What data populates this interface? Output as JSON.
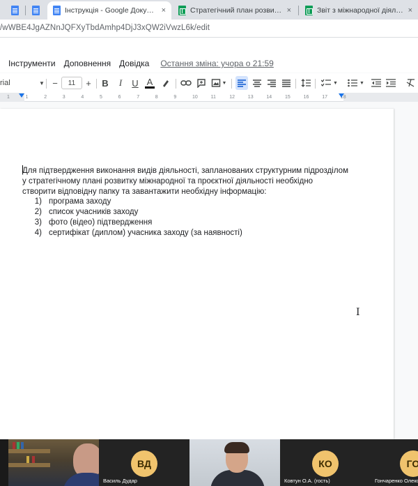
{
  "browser": {
    "tabs": [
      {
        "title": "",
        "icon": "docs-icon"
      },
      {
        "title": "",
        "icon": "docs-icon"
      },
      {
        "title": "Інструкція - Google Документи",
        "icon": "docs-icon",
        "active": true
      },
      {
        "title": "Стратегічний план розвитку між",
        "icon": "sheets-icon"
      },
      {
        "title": "Звіт з міжнародної діяльності -",
        "icon": "sheets-icon"
      }
    ],
    "close_glyph": "×",
    "url": "/wWBE4JgAZNnJQFXyTbdAmhp4DjJ3xQW2iVwzL6k/edit"
  },
  "menubar": {
    "items": [
      "Інструменти",
      "Доповнення",
      "Довідка"
    ],
    "last_edit": "Остання зміна: учора о 21:59"
  },
  "toolbar": {
    "font": "rial",
    "font_size": "11",
    "minus": "−",
    "plus": "+",
    "bold": "B",
    "italic": "I",
    "underline": "U",
    "text_color": "A",
    "highlight_color": "#fbbc04",
    "text_color_value": "#000000"
  },
  "ruler": {
    "ticks": [
      "1",
      "1",
      "2",
      "3",
      "4",
      "5",
      "6",
      "7",
      "8",
      "9",
      "10",
      "11",
      "12",
      "13",
      "14",
      "15",
      "16",
      "17",
      "18"
    ]
  },
  "document": {
    "paragraph": [
      "Для підтвердження виконання видів діяльності, запланованих структурним підрозділом",
      "у стратегічному плані розвитку міжнародної та проєктної діяльності необхідно",
      "створити відповідну папку та завантажити необхідну  інформацію:"
    ],
    "list": [
      {
        "num": "1)",
        "text": "програма заходу"
      },
      {
        "num": "2)",
        "text": "список учасників заходу"
      },
      {
        "num": "3)",
        "text": "фото (відео) підтвердження"
      },
      {
        "num": "4)",
        "text": "сертифікат (диплом) учасника заходу (за наявності)"
      }
    ]
  },
  "video": {
    "participants": [
      {
        "name": "",
        "type": "photo"
      },
      {
        "name": "Василь Дудар",
        "initials": "ВД",
        "type": "avatar"
      },
      {
        "name": "",
        "type": "photo"
      },
      {
        "name": "Ковтун О.А. (гость)",
        "initials": "КО",
        "type": "avatar"
      },
      {
        "name": "Гончаренко Олекс",
        "initials": "ГО",
        "type": "avatar"
      }
    ]
  }
}
